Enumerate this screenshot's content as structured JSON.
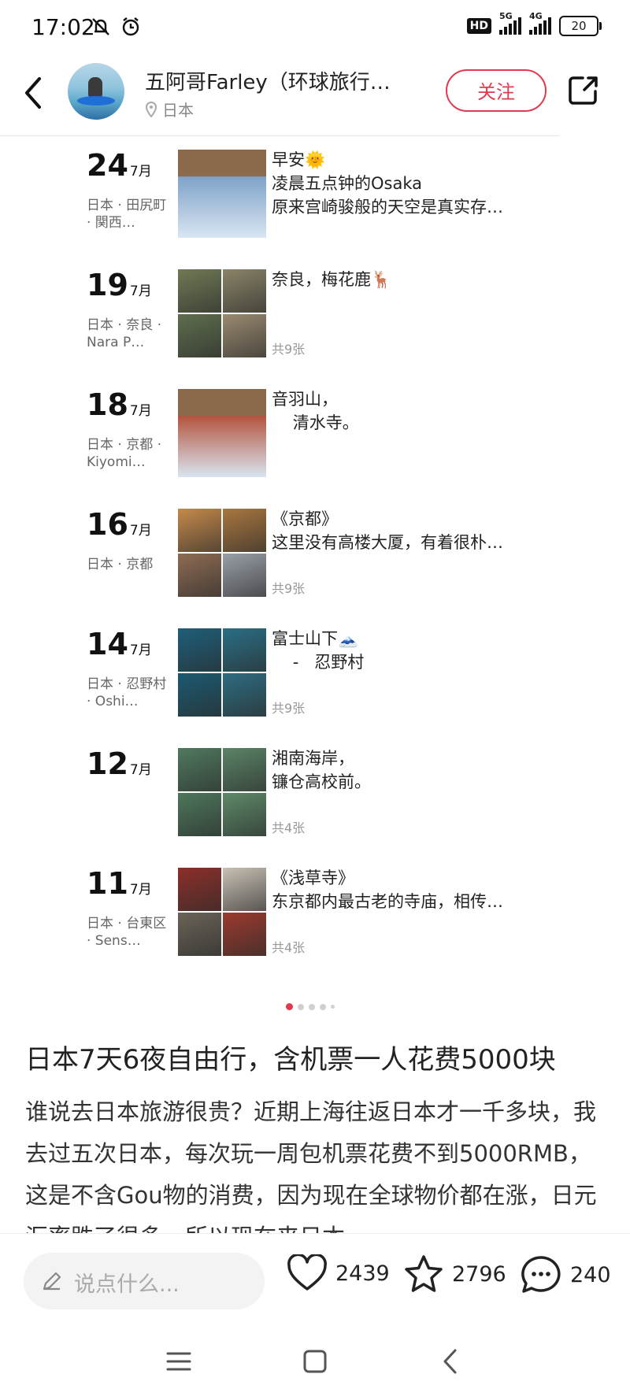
{
  "status_bar": {
    "time": "17:02",
    "hd_label": "HD",
    "signal1_label": "5G",
    "signal2_label": "4G",
    "battery": "20"
  },
  "header": {
    "author": "五阿哥Farley（环球旅行…",
    "location": "日本",
    "follow_label": "关注"
  },
  "timeline": [
    {
      "day": "24",
      "month": "7月",
      "place": "日本 · 田尻町 · 関西…",
      "lines": [
        "早安🌞",
        "凌晨五点钟的Osaka",
        "原来宫崎骏般的天空是真实存…"
      ],
      "count": "",
      "thumb_type": "single",
      "colors": [
        "#7fa3c9"
      ]
    },
    {
      "day": "19",
      "month": "7月",
      "place": "日本 · 奈良 · Nara P…",
      "lines": [
        "奈良，梅花鹿🦌"
      ],
      "count": "共9张",
      "thumb_type": "grid",
      "colors": [
        "#6f7a55",
        "#8a8468",
        "#5e6e4d",
        "#9a8a70"
      ]
    },
    {
      "day": "18",
      "month": "7月",
      "place": "日本 · 京都 · Kiyomi…",
      "lines": [
        "音羽山，",
        "    清水寺。"
      ],
      "count": "",
      "thumb_type": "single",
      "colors": [
        "#b4553f"
      ]
    },
    {
      "day": "16",
      "month": "7月",
      "place": "日本 · 京都",
      "lines": [
        "《京都》",
        "这里没有高楼大厦，有着很朴…"
      ],
      "count": "共9张",
      "thumb_type": "grid",
      "colors": [
        "#c58a4a",
        "#a9773f",
        "#8e6b53",
        "#9aa0a8"
      ]
    },
    {
      "day": "14",
      "month": "7月",
      "place": "日本 · 忍野村 · Oshi…",
      "lines": [
        "富士山下🗻",
        "    -   忍野村"
      ],
      "count": "共9张",
      "thumb_type": "grid",
      "colors": [
        "#1e5f7a",
        "#2a6f85",
        "#1b5a70",
        "#2d6c80"
      ]
    },
    {
      "day": "12",
      "month": "7月",
      "place": "",
      "lines": [
        "湘南海岸，",
        "镰仓高校前。"
      ],
      "count": "共4张",
      "thumb_type": "grid",
      "colors": [
        "#4f7a5f",
        "#5a8466",
        "#4d775b",
        "#5d8a68"
      ]
    },
    {
      "day": "11",
      "month": "7月",
      "place": "日本 · 台東区 · Sens…",
      "lines": [
        "《浅草寺》",
        "东京都内最古老的寺庙，相传…"
      ],
      "count": "共4张",
      "thumb_type": "grid",
      "colors": [
        "#8c2f2a",
        "#c9c1b4",
        "#6a6357",
        "#9b3a2e"
      ]
    }
  ],
  "article": {
    "title": "日本7天6夜自由行，含机票一人花费5000块",
    "body": "谁说去日本旅游很贵？近期上海往返日本才一千多块，我去过五次日本，每次玩一周包机票花费不到5000RMB，这是不含Gou物的消费，因为现在全球物价都在涨，日元汇率跌了很多，所以现在来日本"
  },
  "bottom_bar": {
    "comment_placeholder": "说点什么...",
    "likes": "2439",
    "favorites": "2796",
    "comments": "240"
  }
}
